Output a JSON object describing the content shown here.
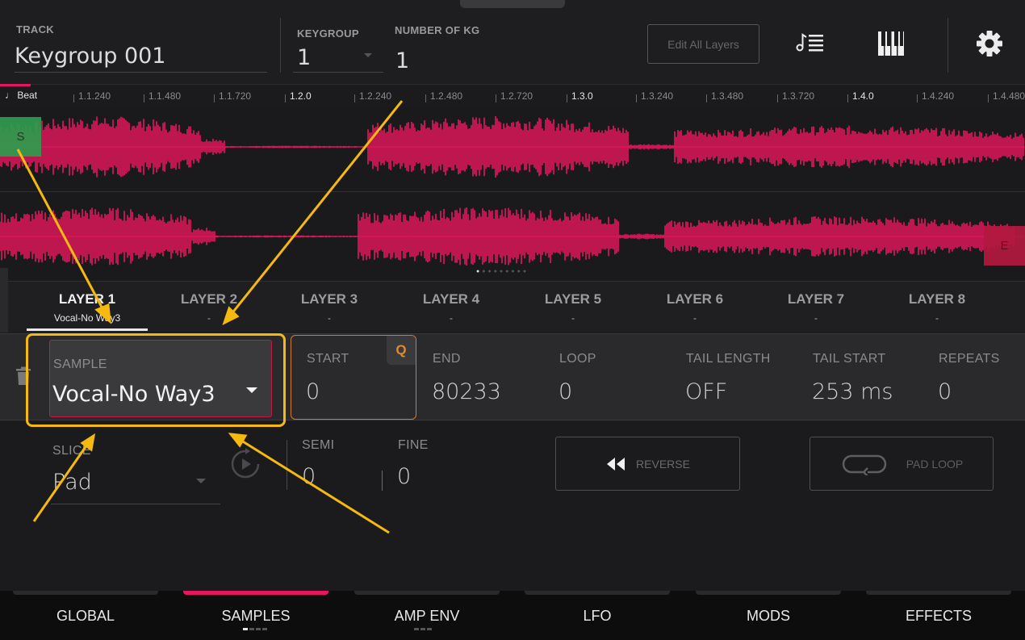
{
  "header": {
    "track_label": "TRACK",
    "track_value": "Keygroup 001",
    "keygroup_label": "KEYGROUP",
    "keygroup_value": "1",
    "num_kg_label": "NUMBER OF KG",
    "num_kg_value": "1",
    "edit_all_label": "Edit All Layers"
  },
  "ruler": {
    "beat_label": "Beat",
    "ticks": [
      "1.1.240",
      "1.1.480",
      "1.1.720",
      "1.2.0",
      "1.2.240",
      "1.2.480",
      "1.2.720",
      "1.3.0",
      "1.3.240",
      "1.3.480",
      "1.3.720",
      "1.4.0",
      "1.4.240",
      "1.4.480"
    ]
  },
  "markers": {
    "start": "S",
    "end": "E"
  },
  "waveform": {
    "color": "#e8175d"
  },
  "layers": [
    {
      "name": "LAYER 1",
      "sample": "Vocal-No Way3"
    },
    {
      "name": "LAYER 2",
      "sample": "-"
    },
    {
      "name": "LAYER 3",
      "sample": "-"
    },
    {
      "name": "LAYER 4",
      "sample": "-"
    },
    {
      "name": "LAYER 5",
      "sample": "-"
    },
    {
      "name": "LAYER 6",
      "sample": "-"
    },
    {
      "name": "LAYER 7",
      "sample": "-"
    },
    {
      "name": "LAYER 8",
      "sample": "-"
    }
  ],
  "params": {
    "sample_label": "SAMPLE",
    "sample_value": "Vocal-No Way3",
    "start_label": "START",
    "start_value": "0",
    "q_label": "Q",
    "end_label": "END",
    "end_value": "80233",
    "loop_label": "LOOP",
    "loop_value": "0",
    "tail_length_label": "TAIL LENGTH",
    "tail_length_value": "OFF",
    "tail_start_label": "TAIL START",
    "tail_start_value": "253 ms",
    "repeats_label": "REPEATS",
    "repeats_value": "0",
    "slice_label": "SLICE",
    "slice_value": "Pad",
    "semi_label": "SEMI",
    "semi_value": "0",
    "fine_label": "FINE",
    "fine_value": "0",
    "reverse_label": "REVERSE",
    "padloop_label": "PAD LOOP"
  },
  "bottom_tabs": [
    "GLOBAL",
    "SAMPLES",
    "AMP ENV",
    "LFO",
    "MODS",
    "EFFECTS"
  ],
  "colors": {
    "accent": "#e8175d",
    "start_marker": "#2f9c4f",
    "end_marker": "#b2193f",
    "annotation": "#f5b90f",
    "start_border": "#d47a2a"
  }
}
